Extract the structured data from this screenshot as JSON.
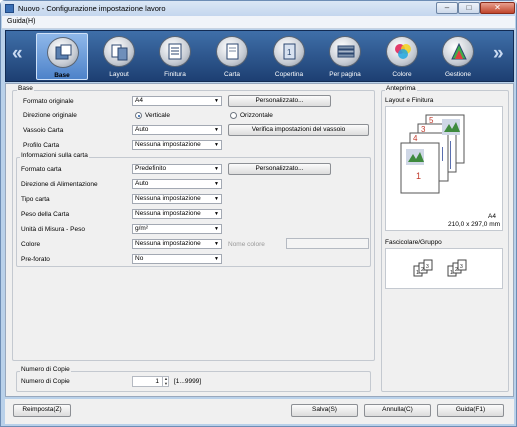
{
  "window": {
    "title": "Nuovo - Configurazione impostazione lavoro",
    "min": "–",
    "max": "□",
    "close": "✕"
  },
  "menu": {
    "help": "Guida(H)"
  },
  "toolbar": {
    "left_arrow": "«",
    "right_arrow": "»",
    "tabs": [
      {
        "label": "Base",
        "icon": "base-icon",
        "active": true
      },
      {
        "label": "Layout",
        "icon": "layout-icon"
      },
      {
        "label": "Finitura",
        "icon": "finishing-icon"
      },
      {
        "label": "Carta",
        "icon": "paper-icon"
      },
      {
        "label": "Copertina",
        "icon": "cover-icon"
      },
      {
        "label": "Per pagina",
        "icon": "per-page-icon"
      },
      {
        "label": "Colore",
        "icon": "color-icon"
      },
      {
        "label": "Gestione",
        "icon": "management-icon"
      }
    ]
  },
  "base": {
    "title": "Base",
    "formato_originale": {
      "label": "Formato originale",
      "value": "A4",
      "button": "Personalizzato..."
    },
    "direzione": {
      "label": "Direzione originale",
      "option1": "Verticale",
      "option2": "Orizzontale",
      "selected": "Verticale"
    },
    "vassoio": {
      "label": "Vassoio Carta",
      "value": "Auto",
      "button": "Verifica impostazioni del vassoio"
    },
    "profilo": {
      "label": "Profilo Carta",
      "value": "Nessuna impostazione"
    }
  },
  "info_carta": {
    "title": "Informazioni sulla carta",
    "formato": {
      "label": "Formato carta",
      "value": "Predefinito",
      "button": "Personalizzato..."
    },
    "alimentazione": {
      "label": "Direzione di Alimentazione",
      "value": "Auto"
    },
    "tipo": {
      "label": "Tipo carta",
      "value": "Nessuna impostazione"
    },
    "peso": {
      "label": "Peso della Carta",
      "value": "Nessuna impostazione"
    },
    "unita": {
      "label": "Unità di Misura - Peso",
      "value": "g/m²"
    },
    "colore": {
      "label": "Colore",
      "value": "Nessuna impostazione",
      "name_label": "Nome colore"
    },
    "preforato": {
      "label": "Pre-forato",
      "value": "No"
    }
  },
  "copie": {
    "title": "Numero di Copie",
    "label": "Numero di Copie",
    "value": "1",
    "range": "[1...9999]"
  },
  "anteprima": {
    "title": "Anteprima",
    "layout_label": "Layout e Finitura",
    "paper_size": "A4",
    "dimensions": "210,0 x 297,0 mm",
    "collate_label": "Fascicolare/Gruppo",
    "page_numbers": [
      "5",
      "3",
      "4",
      "1"
    ]
  },
  "footer": {
    "reset": "Reimposta(Z)",
    "save": "Salva(S)",
    "cancel": "Annulla(C)",
    "help": "Guida(F1)"
  }
}
